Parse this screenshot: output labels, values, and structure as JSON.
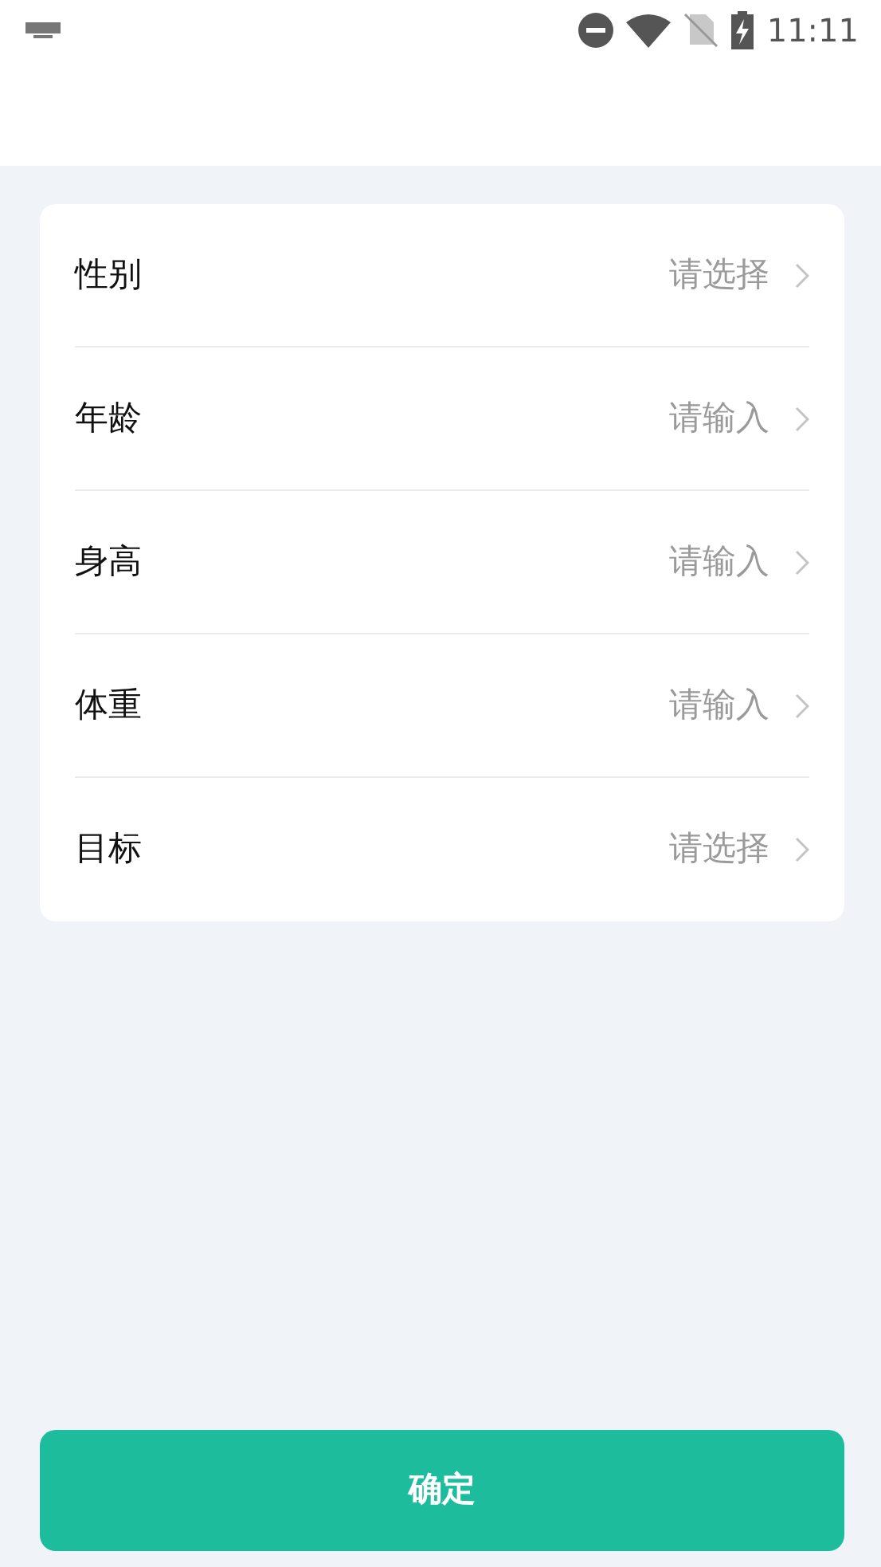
{
  "status_bar": {
    "time": "11:11"
  },
  "form": {
    "rows": [
      {
        "label": "性别",
        "placeholder": "请选择"
      },
      {
        "label": "年龄",
        "placeholder": "请输入"
      },
      {
        "label": "身高",
        "placeholder": "请输入"
      },
      {
        "label": "体重",
        "placeholder": "请输入"
      },
      {
        "label": "目标",
        "placeholder": "请选择"
      }
    ]
  },
  "confirm_button": {
    "label": "确定"
  }
}
